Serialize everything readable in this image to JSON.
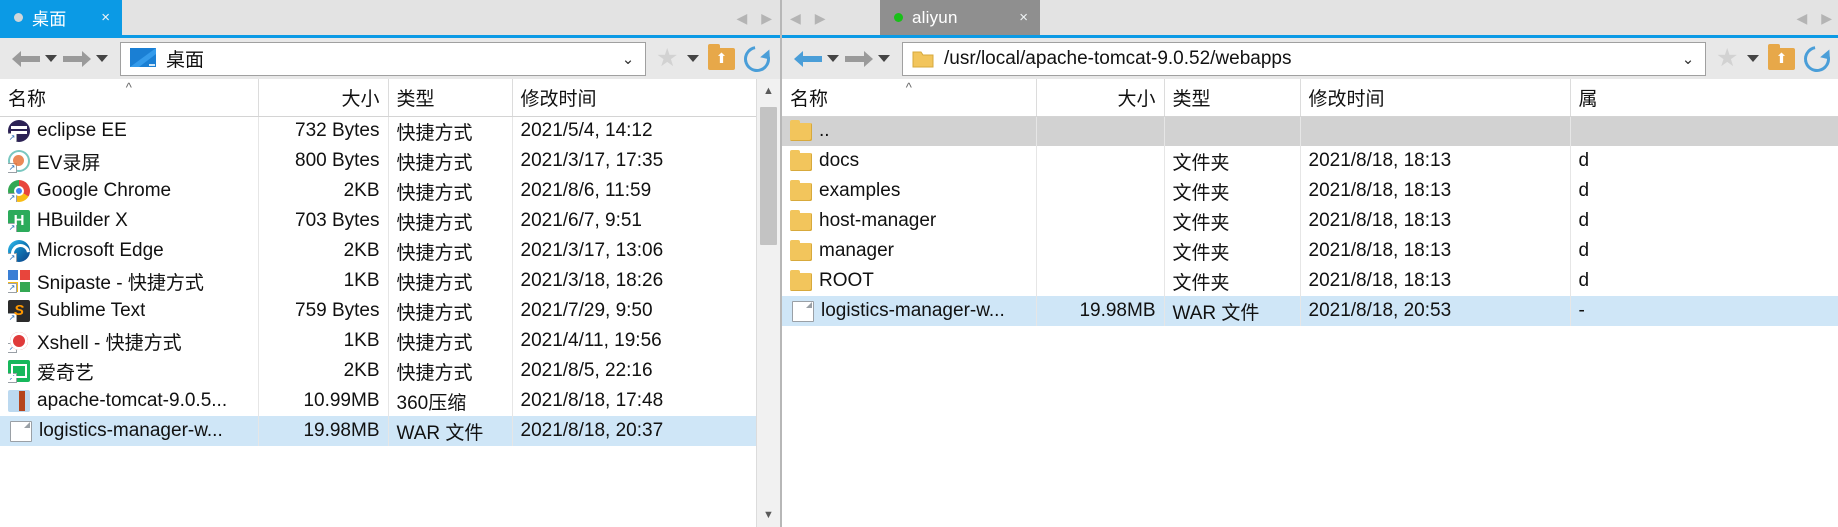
{
  "left_pane": {
    "tab": {
      "label": "桌面",
      "dot": "status-dot-idle",
      "close": "×"
    },
    "tab_nav": {
      "prev": "◀",
      "next": "▶"
    },
    "address": {
      "value": "桌面",
      "icon": "desktop-icon",
      "dropdown_caret": "⌄"
    },
    "toolbar": {
      "back_icon": "back-arrow-icon",
      "back_caret": "▾",
      "forward_icon": "forward-arrow-icon",
      "forward_caret": "▾",
      "bookmark_icon": "star-icon",
      "bookmark_caret": "▾",
      "parent_icon": "folder-up-icon",
      "refresh_icon": "refresh-icon"
    },
    "columns": [
      "名称",
      "大小",
      "类型",
      "修改时间"
    ],
    "sort_indicator": "^",
    "rows": [
      {
        "name": "eclipse EE",
        "icon": "eclipse-icon",
        "shortcut": true,
        "size": "732 Bytes",
        "type": "快捷方式",
        "modified": "2021/5/4, 14:12",
        "state": "normal"
      },
      {
        "name": "EV录屏",
        "icon": "ev-icon",
        "shortcut": true,
        "size": "800 Bytes",
        "type": "快捷方式",
        "modified": "2021/3/17, 17:35",
        "state": "normal"
      },
      {
        "name": "Google Chrome",
        "icon": "chrome-icon",
        "shortcut": true,
        "size": "2KB",
        "type": "快捷方式",
        "modified": "2021/8/6, 11:59",
        "state": "normal"
      },
      {
        "name": "HBuilder X",
        "icon": "hbuilder-icon",
        "shortcut": true,
        "size": "703 Bytes",
        "type": "快捷方式",
        "modified": "2021/6/7, 9:51",
        "state": "normal"
      },
      {
        "name": "Microsoft Edge",
        "icon": "edge-icon",
        "shortcut": true,
        "size": "2KB",
        "type": "快捷方式",
        "modified": "2021/3/17, 13:06",
        "state": "normal"
      },
      {
        "name": "Snipaste - 快捷方式",
        "icon": "snipaste-icon",
        "shortcut": true,
        "size": "1KB",
        "type": "快捷方式",
        "modified": "2021/3/18, 18:26",
        "state": "normal"
      },
      {
        "name": "Sublime Text",
        "icon": "sublime-icon",
        "shortcut": true,
        "size": "759 Bytes",
        "type": "快捷方式",
        "modified": "2021/7/29, 9:50",
        "state": "normal"
      },
      {
        "name": "Xshell - 快捷方式",
        "icon": "xshell-icon",
        "shortcut": true,
        "size": "1KB",
        "type": "快捷方式",
        "modified": "2021/4/11, 19:56",
        "state": "normal"
      },
      {
        "name": "爱奇艺",
        "icon": "iqiyi-icon",
        "shortcut": true,
        "size": "2KB",
        "type": "快捷方式",
        "modified": "2021/8/5, 22:16",
        "state": "normal"
      },
      {
        "name": "apache-tomcat-9.0.5...",
        "icon": "zip-icon",
        "shortcut": false,
        "size": "10.99MB",
        "type": "360压缩",
        "modified": "2021/8/18, 17:48",
        "state": "normal"
      },
      {
        "name": "logistics-manager-w...",
        "icon": "file-icon",
        "shortcut": false,
        "size": "19.98MB",
        "type": "WAR 文件",
        "modified": "2021/8/18, 20:37",
        "state": "selected"
      }
    ],
    "scrollbar": {
      "up": "▲",
      "down": "▼"
    }
  },
  "right_pane": {
    "tab": {
      "label": "aliyun",
      "dot": "status-dot-connected",
      "close": "×"
    },
    "tab_nav": {
      "prev": "◀",
      "next": "▶"
    },
    "address": {
      "value": "/usr/local/apache-tomcat-9.0.52/webapps",
      "icon": "folder-icon",
      "dropdown_caret": "⌄"
    },
    "toolbar": {
      "back_icon": "back-arrow-icon",
      "back_caret": "▾",
      "forward_icon": "forward-arrow-icon",
      "forward_caret": "▾",
      "bookmark_icon": "star-icon",
      "bookmark_caret": "▾",
      "parent_icon": "folder-up-icon",
      "refresh_icon": "refresh-icon"
    },
    "columns": [
      "名称",
      "大小",
      "类型",
      "修改时间",
      "属"
    ],
    "sort_indicator": "^",
    "rows": [
      {
        "name": "..",
        "icon": "folder-icon",
        "size": "",
        "type": "",
        "modified": "",
        "perm": "",
        "state": "hover"
      },
      {
        "name": "docs",
        "icon": "folder-icon",
        "size": "",
        "type": "文件夹",
        "modified": "2021/8/18, 18:13",
        "perm": "d",
        "state": "normal"
      },
      {
        "name": "examples",
        "icon": "folder-icon",
        "size": "",
        "type": "文件夹",
        "modified": "2021/8/18, 18:13",
        "perm": "d",
        "state": "normal"
      },
      {
        "name": "host-manager",
        "icon": "folder-icon",
        "size": "",
        "type": "文件夹",
        "modified": "2021/8/18, 18:13",
        "perm": "d",
        "state": "normal"
      },
      {
        "name": "manager",
        "icon": "folder-icon",
        "size": "",
        "type": "文件夹",
        "modified": "2021/8/18, 18:13",
        "perm": "d",
        "state": "normal"
      },
      {
        "name": "ROOT",
        "icon": "folder-icon",
        "size": "",
        "type": "文件夹",
        "modified": "2021/8/18, 18:13",
        "perm": "d",
        "state": "normal"
      },
      {
        "name": "logistics-manager-w...",
        "icon": "file-icon",
        "size": "19.98MB",
        "type": "WAR 文件",
        "modified": "2021/8/18, 20:53",
        "perm": "-",
        "state": "selected"
      }
    ]
  },
  "colors": {
    "tab_active_blue": "#0b9ae5",
    "tab_active_gray": "#8f8f8f",
    "selection_blue": "#cfe6f7",
    "hover_gray": "#d2d2d2",
    "connected_green": "#18c018",
    "toolbar_bg": "#e8e8e8"
  }
}
